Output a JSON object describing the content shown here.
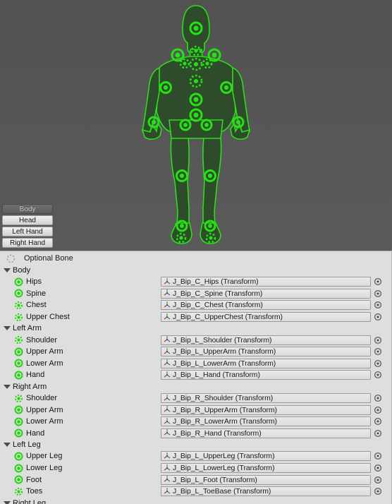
{
  "viewport": {
    "name": "avatar-preview",
    "background_top": "#525252",
    "background_bottom": "#5a5a5a",
    "body_fill": "#2d4a2a",
    "outline_color": "#2ecc1f",
    "joint_color": "#22d40f"
  },
  "tabs": [
    {
      "label": "Body",
      "active": true
    },
    {
      "label": "Head",
      "active": false
    },
    {
      "label": "Left Hand",
      "active": false
    },
    {
      "label": "Right Hand",
      "active": false
    }
  ],
  "legend": {
    "optional_bone_label": "Optional Bone"
  },
  "groups": [
    {
      "name": "Body",
      "expanded": true,
      "bones": [
        {
          "label": "Hips",
          "optional": false,
          "value": "J_Bip_C_Hips (Transform)"
        },
        {
          "label": "Spine",
          "optional": false,
          "value": "J_Bip_C_Spine (Transform)"
        },
        {
          "label": "Chest",
          "optional": true,
          "value": "J_Bip_C_Chest (Transform)"
        },
        {
          "label": "Upper Chest",
          "optional": true,
          "value": "J_Bip_C_UpperChest (Transform)"
        }
      ]
    },
    {
      "name": "Left Arm",
      "expanded": true,
      "bones": [
        {
          "label": "Shoulder",
          "optional": true,
          "value": "J_Bip_L_Shoulder (Transform)"
        },
        {
          "label": "Upper Arm",
          "optional": false,
          "value": "J_Bip_L_UpperArm (Transform)"
        },
        {
          "label": "Lower Arm",
          "optional": false,
          "value": "J_Bip_L_LowerArm (Transform)"
        },
        {
          "label": "Hand",
          "optional": false,
          "value": "J_Bip_L_Hand (Transform)"
        }
      ]
    },
    {
      "name": "Right Arm",
      "expanded": true,
      "bones": [
        {
          "label": "Shoulder",
          "optional": true,
          "value": "J_Bip_R_Shoulder (Transform)"
        },
        {
          "label": "Upper Arm",
          "optional": false,
          "value": "J_Bip_R_UpperArm (Transform)"
        },
        {
          "label": "Lower Arm",
          "optional": false,
          "value": "J_Bip_R_LowerArm (Transform)"
        },
        {
          "label": "Hand",
          "optional": false,
          "value": "J_Bip_R_Hand (Transform)"
        }
      ]
    },
    {
      "name": "Left Leg",
      "expanded": true,
      "bones": [
        {
          "label": "Upper Leg",
          "optional": false,
          "value": "J_Bip_L_UpperLeg (Transform)"
        },
        {
          "label": "Lower Leg",
          "optional": false,
          "value": "J_Bip_L_LowerLeg (Transform)"
        },
        {
          "label": "Foot",
          "optional": false,
          "value": "J_Bip_L_Foot (Transform)"
        },
        {
          "label": "Toes",
          "optional": true,
          "value": "J_Bip_L_ToeBase (Transform)"
        }
      ]
    },
    {
      "name": "Right Leg",
      "expanded": true,
      "bones": []
    }
  ]
}
